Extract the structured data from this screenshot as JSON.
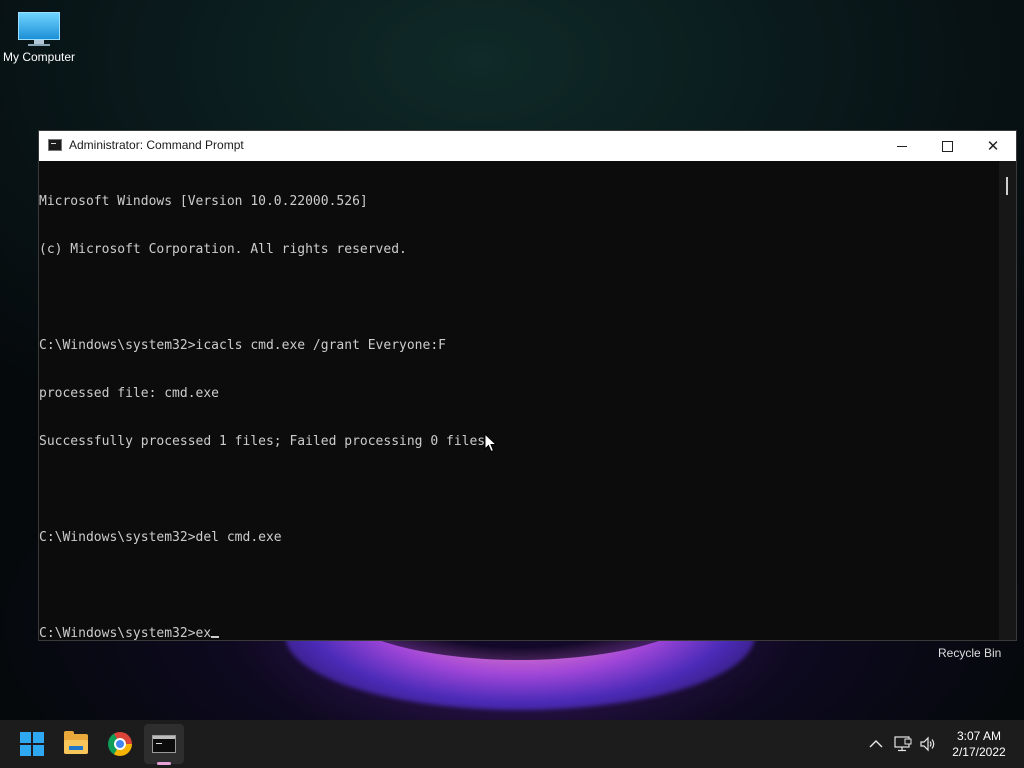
{
  "desktop": {
    "icons": [
      {
        "label": "My Computer",
        "icon": "computer-icon"
      }
    ],
    "recycle_bin_label": "Recycle Bin"
  },
  "window": {
    "title": "Administrator: Command Prompt",
    "icon": "cmd-icon",
    "controls": {
      "minimize": "minimize-icon",
      "maximize": "maximize-icon",
      "close": "close-icon"
    },
    "console_lines": [
      "Microsoft Windows [Version 10.0.22000.526]",
      "(c) Microsoft Corporation. All rights reserved.",
      "",
      "C:\\Windows\\system32>icacls cmd.exe /grant Everyone:F",
      "processed file: cmd.exe",
      "Successfully processed 1 files; Failed processing 0 files",
      "",
      "C:\\Windows\\system32>del cmd.exe",
      "",
      "C:\\Windows\\system32>ex"
    ]
  },
  "taskbar": {
    "apps": [
      {
        "name": "Start",
        "icon": "windows-logo-icon"
      },
      {
        "name": "File Explorer",
        "icon": "folder-icon"
      },
      {
        "name": "Google Chrome",
        "icon": "chrome-icon"
      },
      {
        "name": "Command Prompt",
        "icon": "cmd-icon",
        "active": true
      }
    ],
    "tray": {
      "icons": [
        "chevron-up-icon",
        "network-icon",
        "volume-icon"
      ],
      "time": "3:07 AM",
      "date": "2/17/2022"
    }
  },
  "colors": {
    "console_bg": "#0c0c0c",
    "console_text": "#cccccc",
    "titlebar_bg": "#ffffff",
    "taskbar_bg": "#1c1c1c",
    "accent_pill": "#e7a3d8"
  }
}
